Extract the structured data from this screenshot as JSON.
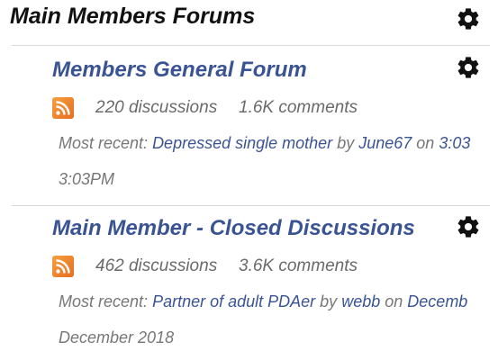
{
  "section": {
    "title": "Main Members Forums"
  },
  "forums": [
    {
      "title": "Members General Forum",
      "discussions": "220 discussions",
      "comments": "1.6K comments",
      "recent_prefix": "Most recent:",
      "recent_topic": "Depressed single mother",
      "by": "by",
      "author": "June67",
      "on": "on",
      "recent_date": "3:03",
      "date_line": "3:03PM"
    },
    {
      "title": "Main Member - Closed Discussions",
      "discussions": "462 discussions",
      "comments": "3.6K comments",
      "recent_prefix": "Most recent:",
      "recent_topic": "Partner of adult PDAer",
      "by": "by",
      "author": "webb",
      "on": "on",
      "recent_date": "Decemb",
      "date_line": "December 2018"
    }
  ],
  "icons": {
    "settings": "gear-icon",
    "feed": "rss-icon"
  },
  "colors": {
    "link": "#3a5493",
    "muted": "#777777",
    "rss": "#e56d1f"
  }
}
